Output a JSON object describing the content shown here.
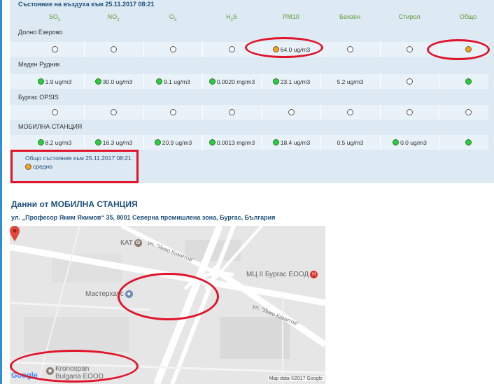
{
  "panel": {
    "title": "Състояние на въздуха към 25.11.2017 08:21",
    "headers": [
      {
        "main": "SO",
        "sub": "2"
      },
      {
        "main": "NO",
        "sub": "2"
      },
      {
        "main": "O",
        "sub": "3"
      },
      {
        "main": "H",
        "sub": "2",
        "tail": "S"
      },
      {
        "main": "PM10",
        "sub": ""
      },
      {
        "main": "Бензен",
        "sub": ""
      },
      {
        "main": "Стирол",
        "sub": ""
      },
      {
        "main": "Общо",
        "sub": ""
      }
    ],
    "stations": [
      {
        "name": "Долно Езерово",
        "cells": [
          {
            "status": "none",
            "value": ""
          },
          {
            "status": "none",
            "value": ""
          },
          {
            "status": "none",
            "value": ""
          },
          {
            "status": "none",
            "value": ""
          },
          {
            "status": "orange",
            "value": "64.0 ug/m3"
          },
          {
            "status": "none",
            "value": ""
          },
          {
            "status": "none",
            "value": ""
          },
          {
            "status": "orange",
            "value": ""
          }
        ]
      },
      {
        "name": "Меден Рудник",
        "cells": [
          {
            "status": "green",
            "value": "1.9 ug/m3"
          },
          {
            "status": "green",
            "value": "30.0 ug/m3"
          },
          {
            "status": "green",
            "value": "9.1 ug/m3"
          },
          {
            "status": "green",
            "value": "0.0020 mg/m3"
          },
          {
            "status": "green",
            "value": "23.1 ug/m3"
          },
          {
            "status": "text",
            "value": "5.2 ug/m3"
          },
          {
            "status": "none",
            "value": ""
          },
          {
            "status": "green",
            "value": ""
          }
        ]
      },
      {
        "name": "Бургас OPSIS",
        "cells": [
          {
            "status": "none",
            "value": ""
          },
          {
            "status": "none",
            "value": ""
          },
          {
            "status": "none",
            "value": ""
          },
          {
            "status": "none",
            "value": ""
          },
          {
            "status": "none",
            "value": ""
          },
          {
            "status": "none",
            "value": ""
          },
          {
            "status": "none",
            "value": ""
          },
          {
            "status": "none",
            "value": ""
          }
        ]
      },
      {
        "name": "МОБИЛНА СТАНЦИЯ",
        "cells": [
          {
            "status": "green",
            "value": "8.2 ug/m3"
          },
          {
            "status": "green",
            "value": "16.3 ug/m3"
          },
          {
            "status": "green",
            "value": "20.9 ug/m3"
          },
          {
            "status": "green",
            "value": "0.0013 mg/m3"
          },
          {
            "status": "green",
            "value": "18.4 ug/m3"
          },
          {
            "status": "text",
            "value": "0.5 ug/m3"
          },
          {
            "status": "green",
            "value": "0.0 ug/m3"
          },
          {
            "status": "green",
            "value": ""
          }
        ]
      }
    ],
    "summary_line1": "Общо състояние към 25.11.2017 08:21",
    "summary_line2": "средно"
  },
  "colors": {
    "good": "#2ecc40",
    "moderate": "#f0a030",
    "annotation": "#e0142a"
  },
  "data_title": "Данни от МОБИЛНА СТАНЦИЯ",
  "address": "ул. „Професор Яким Якимов“ 35, 8001 Северна промишлена зона, Бургас, България",
  "map": {
    "poi_kat": "КАТ",
    "poi_mts": "МЦ II Бургас ЕООД",
    "poi_master": "Мастерхаус",
    "poi_krono_1": "Kronospan",
    "poi_krono_2": "Bulgaria EOOD",
    "street_1": "ул. \"Янко Комитов\"",
    "street_2": "ул. \"Янко Комитов\"",
    "google": "Google",
    "map_data": "Map data ©2017 Google"
  }
}
